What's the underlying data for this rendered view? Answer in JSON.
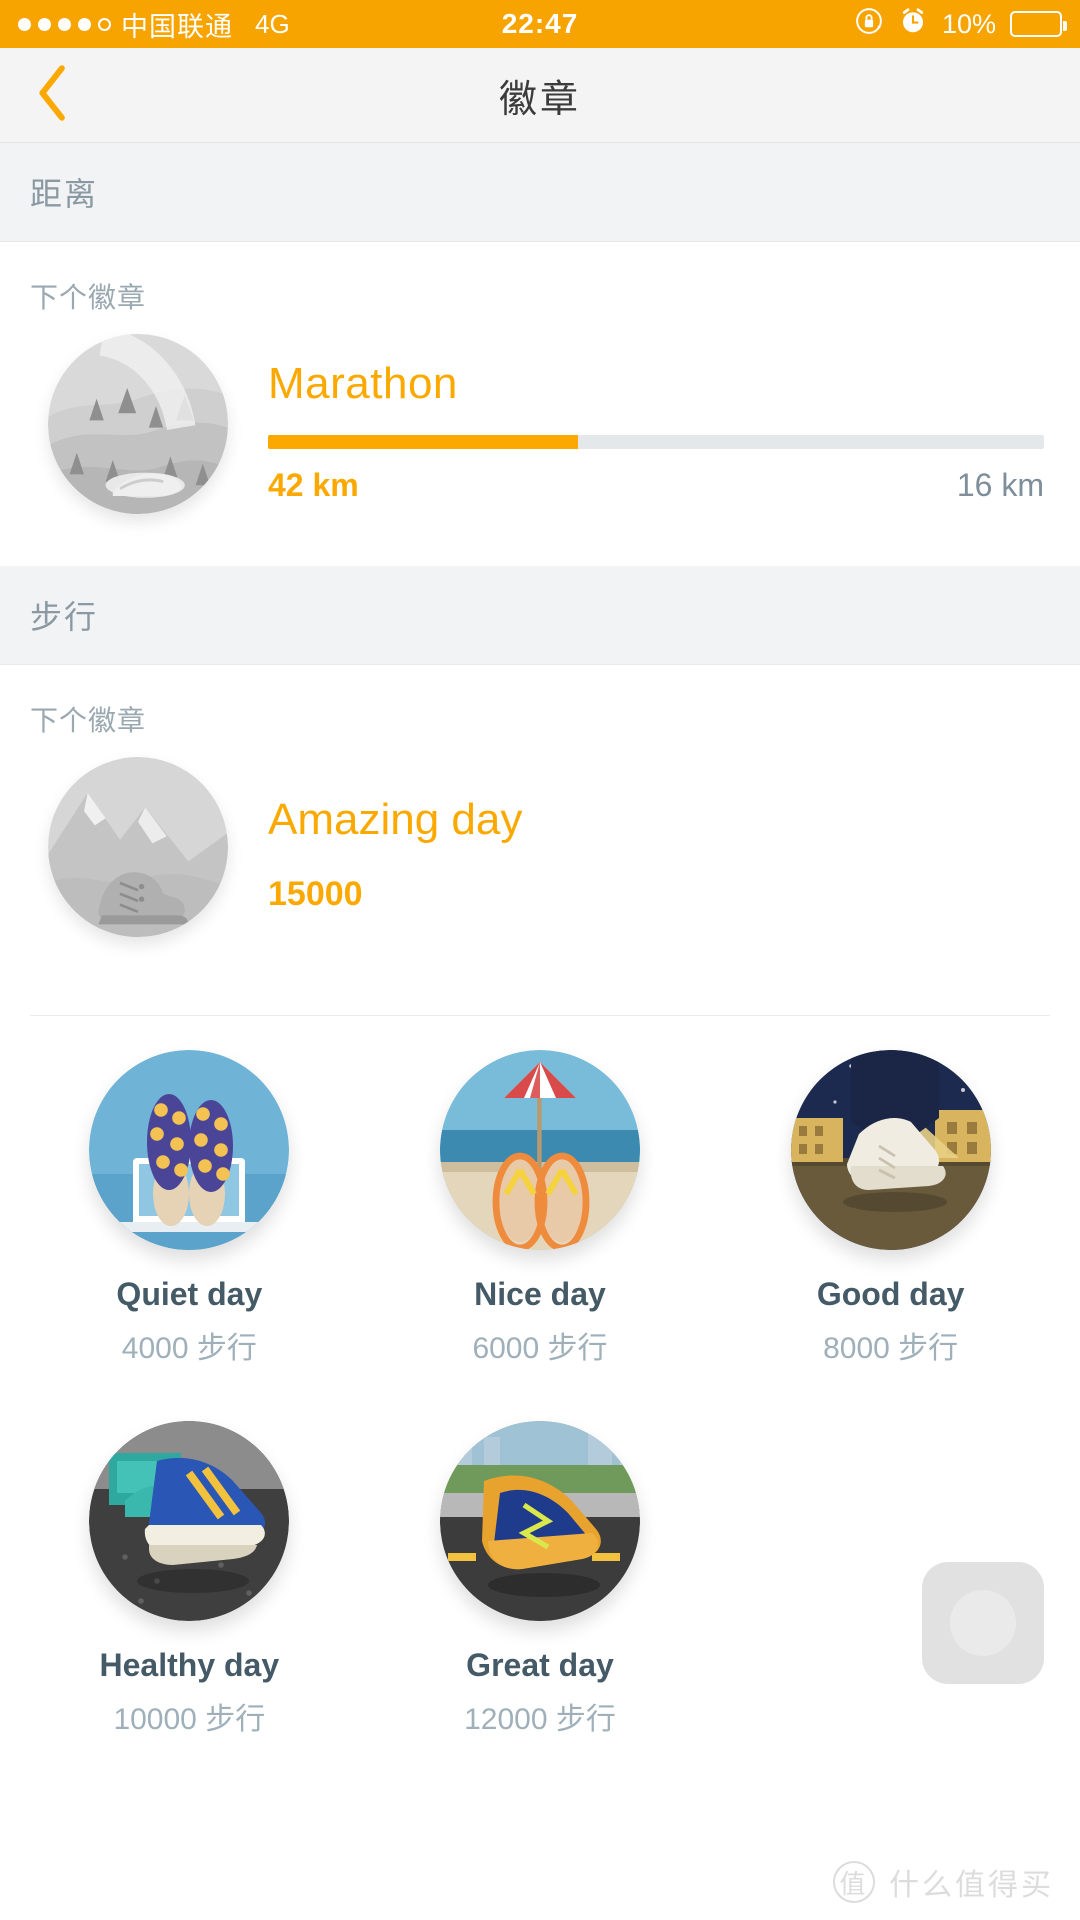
{
  "status_bar": {
    "carrier": "中国联通",
    "network": "4G",
    "time": "22:47",
    "battery_percent": "10%",
    "battery_level": 10,
    "signal_dots_filled": 4,
    "signal_dots_total": 5,
    "icons": [
      "rotation-lock-icon",
      "alarm-clock-icon",
      "battery-icon"
    ],
    "colors": {
      "background": "#F7A300",
      "battery_fill": "#F23A2E"
    }
  },
  "nav": {
    "title": "徽章",
    "back_icon": "chevron-left-icon",
    "accent": "#FBA900"
  },
  "sections": [
    {
      "header": "距离",
      "next_label": "下个徽章",
      "badge": {
        "title": "Marathon",
        "current": "42 km",
        "remaining": "16 km",
        "progress_percent": 40,
        "art": "hills-landscape-locked"
      }
    },
    {
      "header": "步行",
      "next_label": "下个徽章",
      "badge": {
        "title": "Amazing day",
        "current": "15000",
        "art": "mountain-boot-locked"
      }
    }
  ],
  "earned_badges": [
    {
      "name": "Quiet day",
      "sub": "4000 步行",
      "art": "slippers-laptop"
    },
    {
      "name": "Nice day",
      "sub": "6000 步行",
      "art": "beach-flipflops"
    },
    {
      "name": "Good day",
      "sub": "8000 步行",
      "art": "night-city-dressshoes"
    },
    {
      "name": "Healthy day",
      "sub": "10000 步行",
      "art": "skateboard-sneakers"
    },
    {
      "name": "Great day",
      "sub": "12000 步行",
      "art": "road-running-shoes"
    }
  ],
  "fab": {
    "icon": "assistive-touch-button"
  },
  "watermark": {
    "logo": "值",
    "text": "什么值得买"
  },
  "colors": {
    "accent_orange": "#FBA900",
    "section_bg": "#F2F3F4",
    "text_dark": "#445a66",
    "text_muted": "#9fb0bb",
    "track": "#E4E8EA"
  }
}
